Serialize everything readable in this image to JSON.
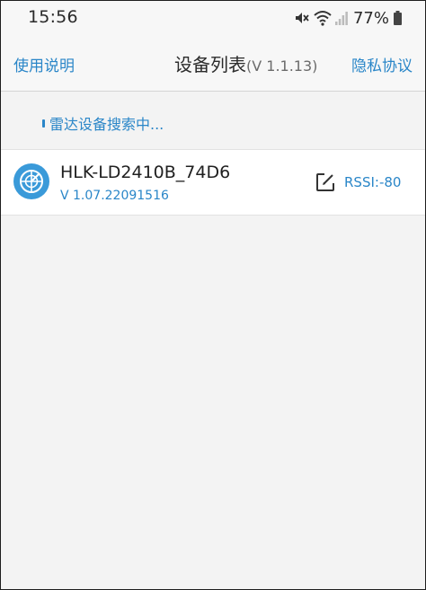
{
  "status_bar": {
    "time": "15:56",
    "battery_percent": "77%",
    "icons": [
      "mute-icon",
      "wifi-icon",
      "cellular-signal-icon",
      "battery-icon"
    ]
  },
  "header": {
    "help_label": "使用说明",
    "title": "设备列表",
    "version": "(V 1.1.13)",
    "privacy_label": "隐私协议"
  },
  "scan_status": "雷达设备搜索中...",
  "devices": [
    {
      "name": "HLK-LD2410B_74D6",
      "version": "V 1.07.22091516",
      "rssi": "RSSI:-80",
      "icon": "radar-device-icon"
    }
  ],
  "colors": {
    "accent": "#2a86c8",
    "background": "#f3f3f3",
    "header_background": "#f7f7f7",
    "card_background": "#ffffff"
  }
}
